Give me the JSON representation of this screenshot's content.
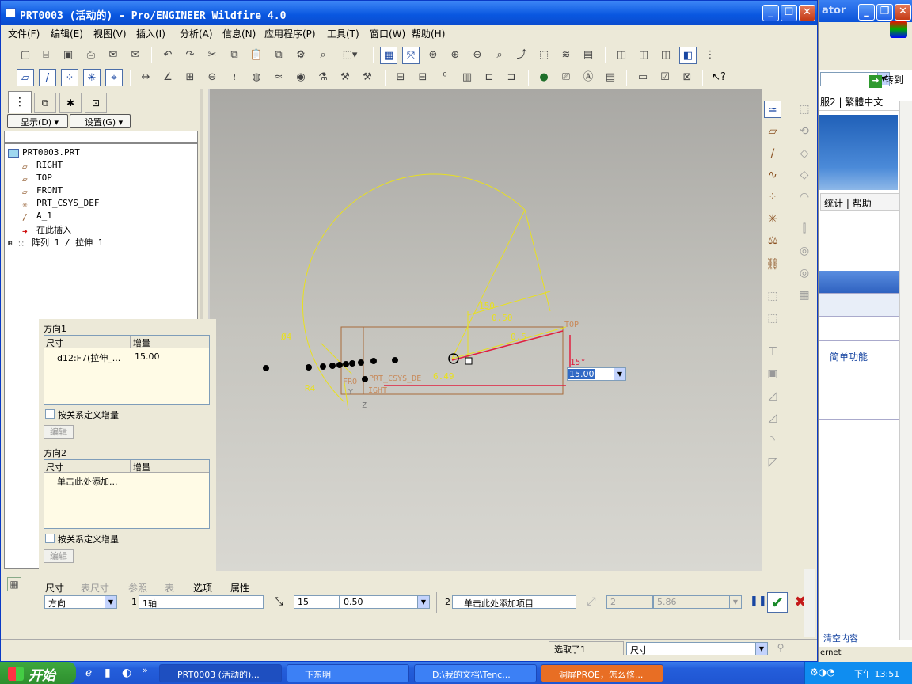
{
  "window": {
    "title": "PRT0003 (活动的) - Pro/ENGINEER Wildfire 4.0"
  },
  "bg_window": {
    "title": "ator",
    "address_go": "转到",
    "lang_link": "服2 | 繁體中文",
    "tab_stats": "统计",
    "tab_help": "帮助",
    "simple": "简单功能",
    "clear": "清空内容",
    "internet": "ernet"
  },
  "menu": [
    "文件(F)",
    "编辑(E)",
    "视图(V)",
    "插入(I)",
    "分析(A)",
    "信息(N)",
    "应用程序(P)",
    "工具(T)",
    "窗口(W)",
    "帮助(H)"
  ],
  "panel": {
    "show_btn": "显示(D)",
    "settings_btn": "设置(G)"
  },
  "tree": {
    "root": "PRT0003.PRT",
    "items": [
      "RIGHT",
      "TOP",
      "FRONT",
      "PRT_CSYS_DEF",
      "A_1",
      "在此插入",
      "阵列 1 / 拉伸 1"
    ]
  },
  "popup": {
    "dir1_label": "方向1",
    "col_dim": "尺寸",
    "col_inc": "增量",
    "dir1_row_dim": "d12:F7(拉伸_...",
    "dir1_row_inc": "15.00",
    "rel_label1": "按关系定义增量",
    "edit1": "编辑",
    "dir2_label": "方向2",
    "dir2_row": "单击此处添加...",
    "rel_label2": "按关系定义增量",
    "edit2": "编辑"
  },
  "canvas": {
    "dim_phi": "Ø4",
    "dim_150": "150",
    "dim_050": "0.50",
    "dim_r4": "R4",
    "dim_15": "15°",
    "label_top": "TOP",
    "label_csys": "PRT_CSYS_DE",
    "label_front": "FRO",
    "label_right": "IGHT",
    "label_z": "Z",
    "label_y": "Y",
    "dim_value": "15.00",
    "dim_05": "0.5",
    "dim_649": "6.49"
  },
  "bottom": {
    "tabs": [
      "尺寸",
      "表尺寸",
      "参照",
      "表",
      "选项",
      "属性"
    ],
    "type": "方向",
    "num1": "1",
    "axis1": "1轴",
    "count1": "15",
    "inc1": "0.50",
    "num2": "2",
    "add2": "单击此处添加项目",
    "count2": "2",
    "inc2": "5.86"
  },
  "status": {
    "selected": "选取了1",
    "filter": "尺寸"
  },
  "taskbar": {
    "start": "开始",
    "tasks": [
      "PRT0003 (活动的)...",
      "下东明",
      "D:\\我的文档\\Tenc...",
      "洞屏PROE，怎么修..."
    ],
    "time": "下午 13:51"
  }
}
